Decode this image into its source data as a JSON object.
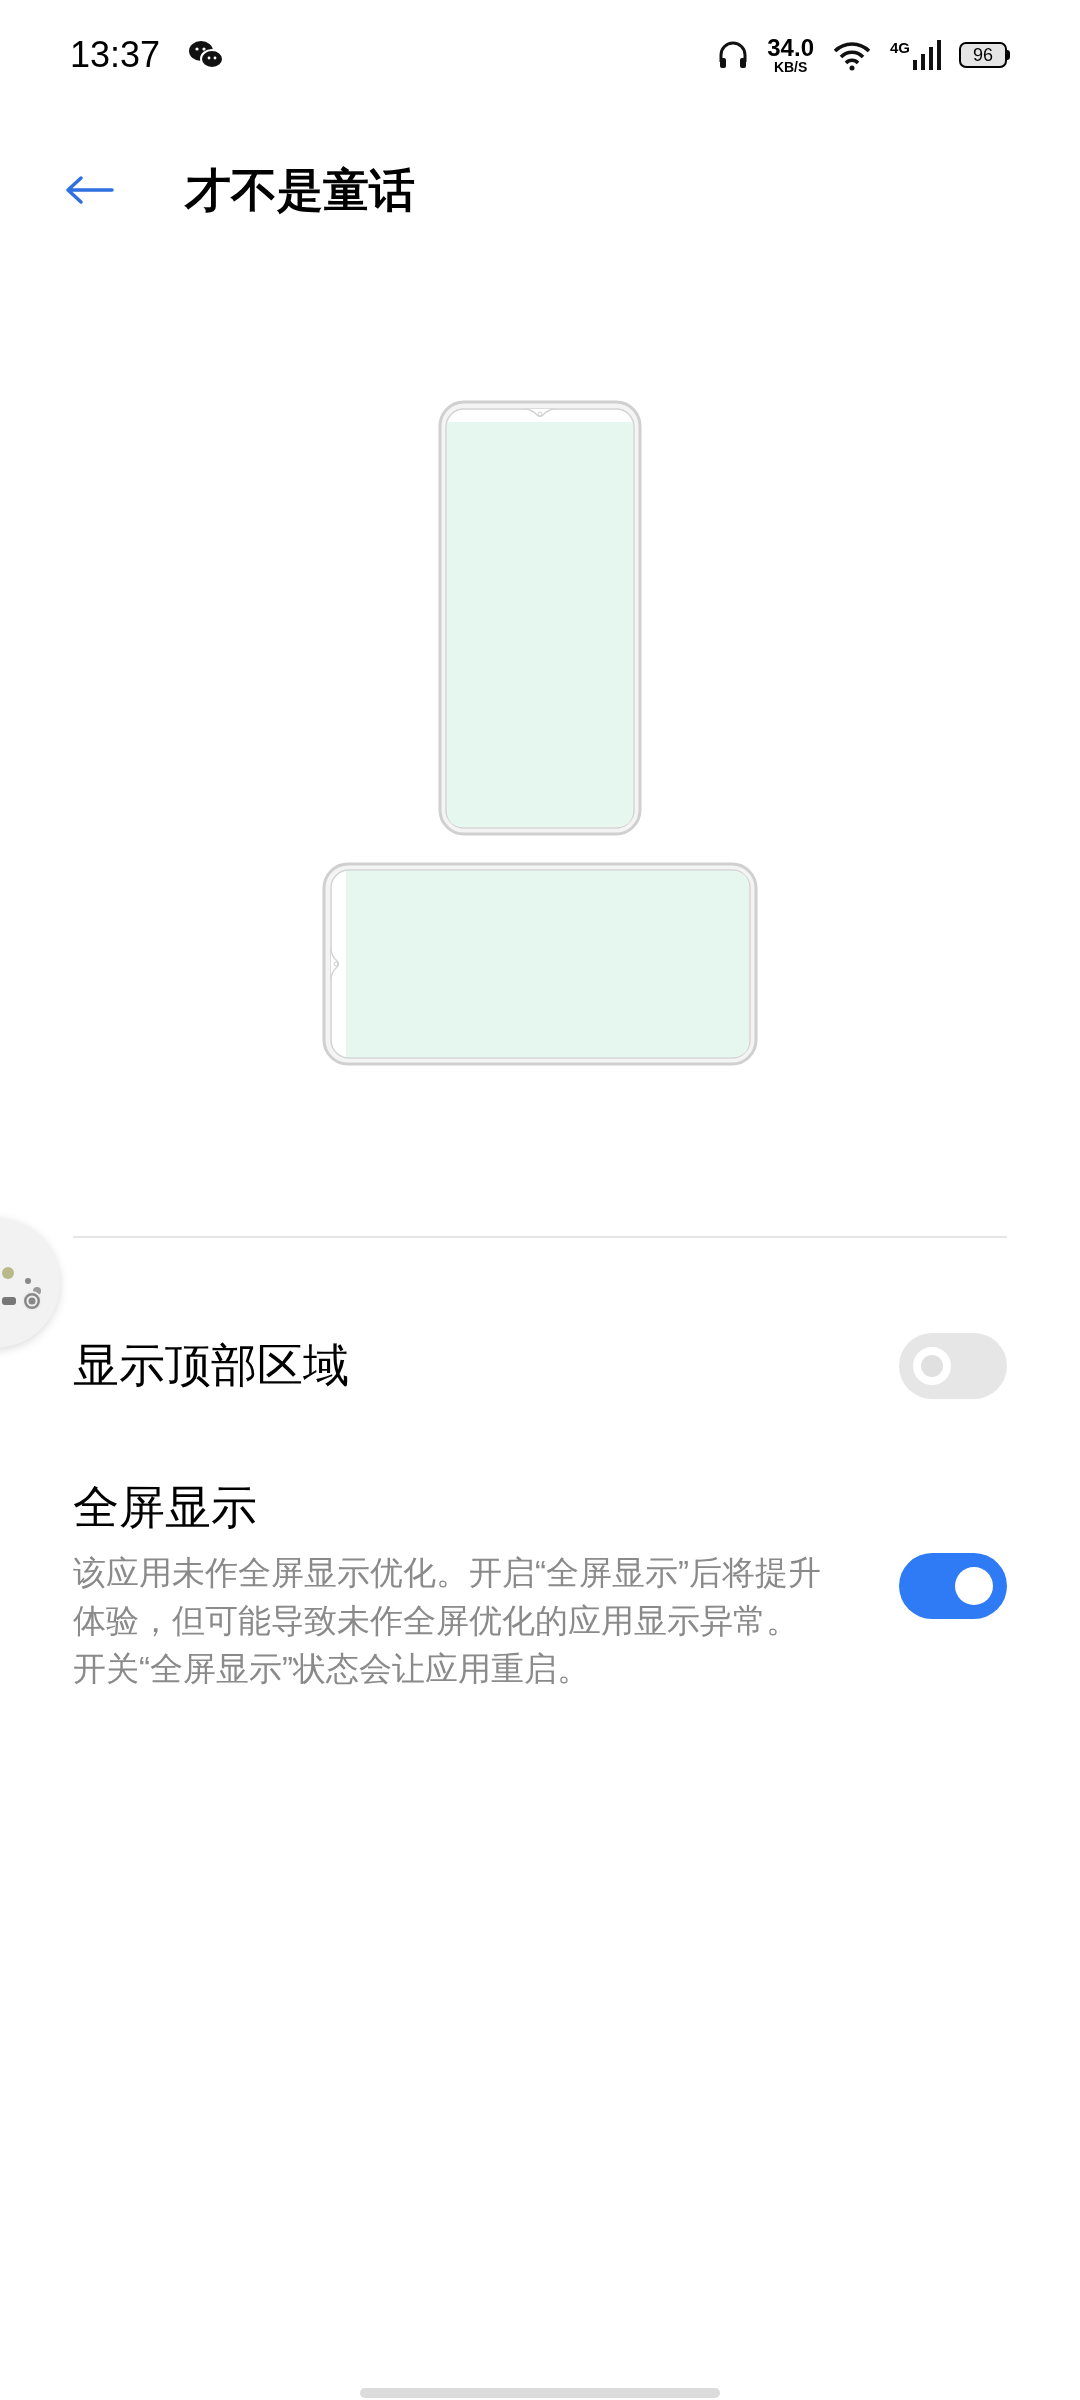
{
  "status_bar": {
    "time": "13:37",
    "net_speed": "34.0",
    "net_unit": "KB/S",
    "network": "4G",
    "battery": "96"
  },
  "header": {
    "title": "才不是童话"
  },
  "settings": [
    {
      "title": "显示顶部区域",
      "on": false
    },
    {
      "title": "全屏显示",
      "description": "该应用未作全屏显示优化。开启“全屏显示”后将提升体验，但可能导致未作全屏优化的应用显示异常。开关“全屏显示”状态会让应用重启。",
      "on": true
    }
  ]
}
